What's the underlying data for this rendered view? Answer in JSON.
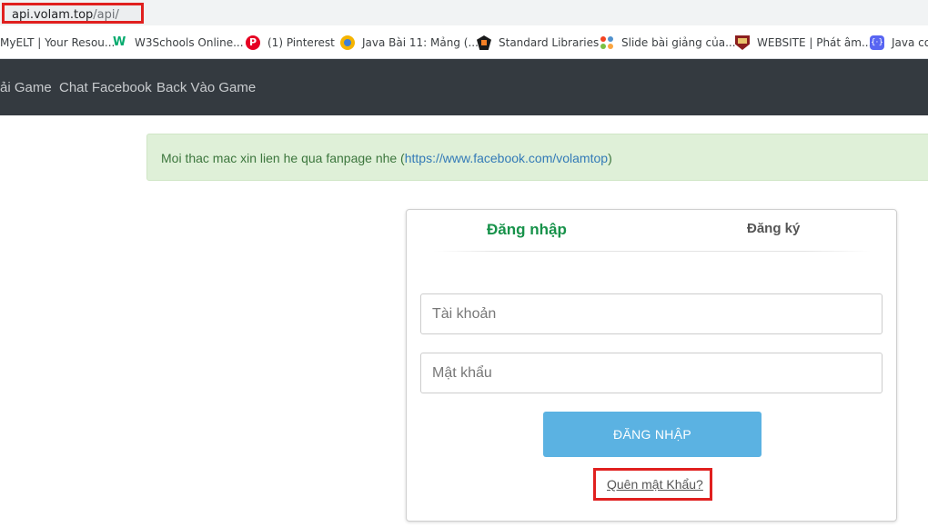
{
  "browser": {
    "url_host": "api.volam.top",
    "url_path": "/api/",
    "bookmarks": [
      {
        "label": "MyELT | Your Resou...",
        "icon": "myelt-icon"
      },
      {
        "label": "W3Schools Online...",
        "icon": "w3schools-icon"
      },
      {
        "label": "(1) Pinterest",
        "icon": "pinterest-icon"
      },
      {
        "label": "Java Bài 11: Mảng (...",
        "icon": "java-icon"
      },
      {
        "label": "Standard Libraries",
        "icon": "princeton-icon"
      },
      {
        "label": "Slide bài giảng của...",
        "icon": "joomla-icon"
      },
      {
        "label": "WEBSITE | Phát âm...",
        "icon": "cambridge-icon"
      },
      {
        "label": "Java cơ",
        "icon": "code-icon"
      }
    ]
  },
  "navbar": {
    "links": [
      "ải Game",
      "Chat Facebook",
      "Back Vào Game"
    ]
  },
  "alert": {
    "text": "Moi thac mac xin lien he qua fanpage nhe (",
    "link": "https://www.facebook.com/volamtop",
    "suffix": ")"
  },
  "login": {
    "tab_login": "Đăng nhập",
    "tab_register": "Đăng ký",
    "username_placeholder": "Tài khoản",
    "password_placeholder": "Mật khẩu",
    "submit_label": "ĐĂNG NHẬP",
    "forgot_label": "Quên mật Khẩu?"
  },
  "colors": {
    "highlight": "#e0201f",
    "navbar": "#343a40",
    "alert_bg": "#dff0d8",
    "login_tab": "#17924a",
    "button": "#5bb2e2"
  }
}
